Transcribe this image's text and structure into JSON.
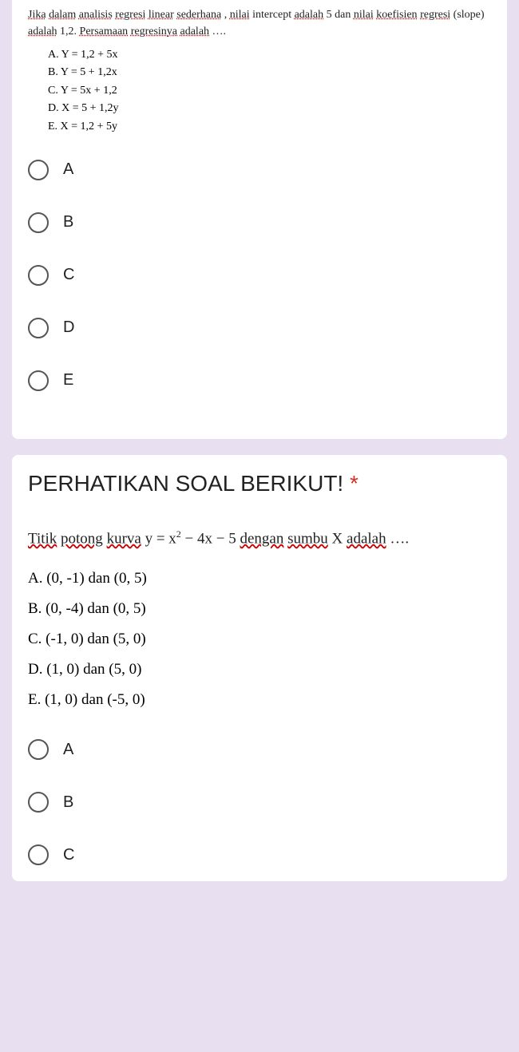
{
  "question1": {
    "prompt_parts": {
      "p1": "Jika",
      "p2": "dalam",
      "p3": "analisis",
      "p4": "regresi",
      "p5": "linear",
      "p6": "sederhana",
      "p7": ", ",
      "p8": "nilai",
      "p9": " intercept ",
      "p10": "adalah",
      "p11": " 5 dan ",
      "p12": "nilai",
      "p13": "koefisien",
      "p14": "regresi",
      "p15": " (slope) ",
      "p16": "adalah",
      "p17": " 1,2. ",
      "p18": "Persamaan",
      "p19": "regresinya",
      "p20": "adalah",
      "p21": "…."
    },
    "sub_options": {
      "a": "A.  Y = 1,2 + 5x",
      "b": "B.  Y = 5 + 1,2x",
      "c": "C.  Y = 5x + 1,2",
      "d": "D.  X = 5 + 1,2y",
      "e": "E.  X = 1,2 + 5y"
    },
    "radio_labels": {
      "a": "A",
      "b": "B",
      "c": "C",
      "d": "D",
      "e": "E"
    }
  },
  "question2": {
    "title": "PERHATIKAN SOAL BERIKUT! ",
    "star": "*",
    "prompt_parts": {
      "p1": "Titik",
      "p2": "potong",
      "p3": "kurva",
      "p4": "  y = x",
      "p5": "2",
      "p6": " − 4x − 5  ",
      "p7": "dengan",
      "p8": "sumbu",
      "p9": " X ",
      "p10": "adalah",
      "p11": "…."
    },
    "sub_options": {
      "a": "A.  (0, -1) dan (0, 5)",
      "b": "B.  (0, -4) dan (0, 5)",
      "c": "C.  (-1, 0) dan (5, 0)",
      "d": "D.  (1, 0) dan (5, 0)",
      "e": "E.  (1, 0) dan (-5, 0)"
    },
    "radio_labels": {
      "a": "A",
      "b": "B",
      "c": "C"
    }
  }
}
